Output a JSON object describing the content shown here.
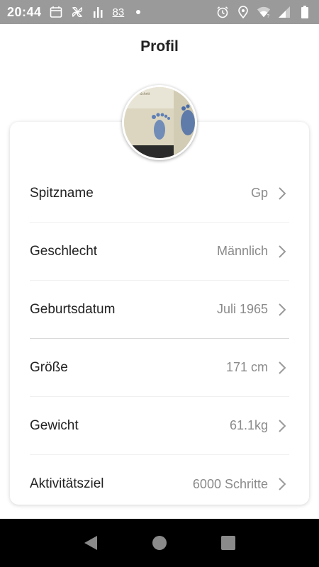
{
  "status_bar": {
    "time": "20:44",
    "notification_count": "83",
    "icons_left": [
      "calendar-icon",
      "pinwheel-icon",
      "bar-graph-icon",
      "dot-icon"
    ],
    "icons_right": [
      "alarm-icon",
      "location-icon",
      "wifi-icon",
      "signal-icon",
      "battery-icon"
    ]
  },
  "header": {
    "title": "Profil"
  },
  "profile": {
    "avatar_icon": "footprint-photo",
    "avatar_caption": "Schritt"
  },
  "rows": [
    {
      "label": "Spitzname",
      "value": "Gp"
    },
    {
      "label": "Geschlecht",
      "value": "Männlich"
    },
    {
      "label": "Geburtsdatum",
      "value": "Juli 1965"
    },
    {
      "label": "Größe",
      "value": "171 cm"
    },
    {
      "label": "Gewicht",
      "value": "61.1kg"
    },
    {
      "label": "Aktivitätsziel",
      "value": "6000 Schritte"
    }
  ],
  "nav_bar": {
    "buttons": [
      "back-icon",
      "home-icon",
      "recents-icon"
    ]
  },
  "colors": {
    "status_bar_bg": "#9a9a9a",
    "title": "#222222",
    "value_text": "#8a8a8a",
    "nav_bar_bg": "#000000"
  }
}
